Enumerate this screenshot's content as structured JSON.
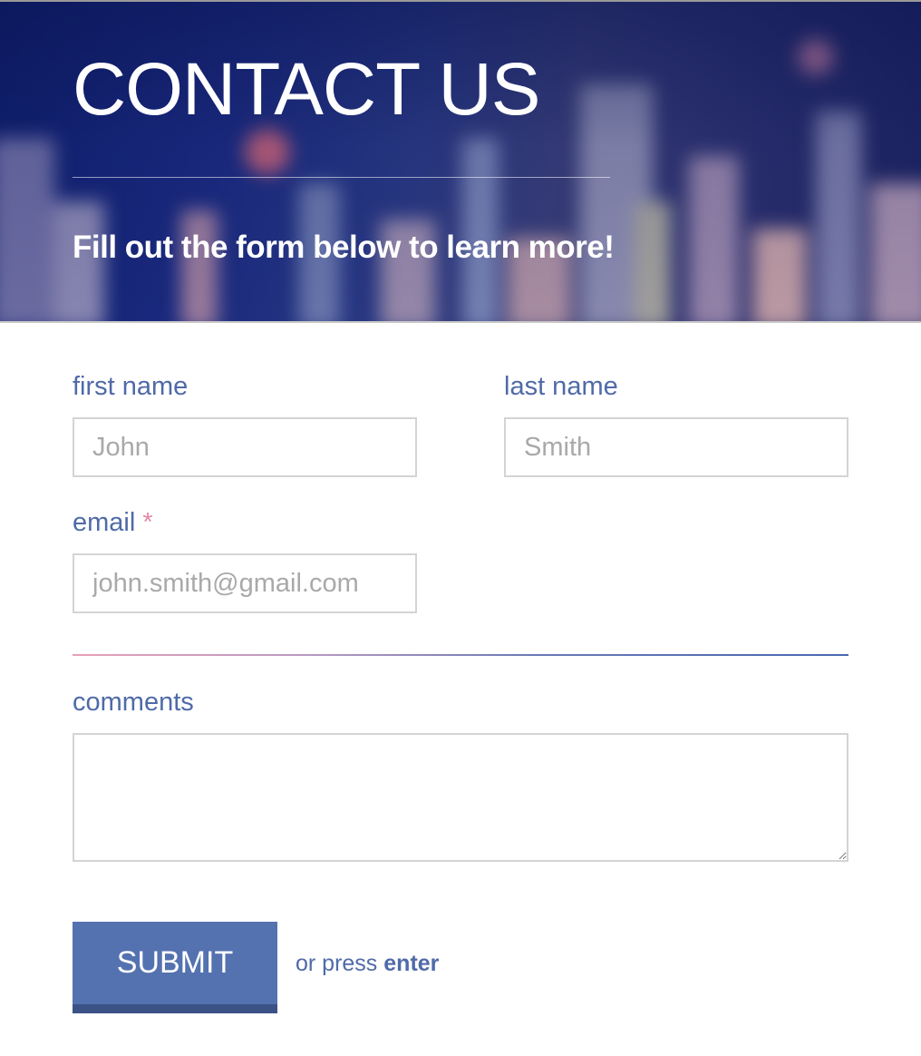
{
  "header": {
    "title": "CONTACT US",
    "subtitle": "Fill out the form below to learn more!"
  },
  "form": {
    "first_name": {
      "label": "first name",
      "placeholder": "John"
    },
    "last_name": {
      "label": "last name",
      "placeholder": "Smith"
    },
    "email": {
      "label": "email",
      "required_mark": "*",
      "placeholder": "john.smith@gmail.com"
    },
    "comments": {
      "label": "comments",
      "value": ""
    },
    "submit_label": "SUBMIT",
    "hint_prefix": "or press",
    "hint_key": "enter"
  },
  "colors": {
    "accent": "#5472b0",
    "accent_dark": "#3b5287",
    "label": "#4f6aa8",
    "required": "#e48aa8",
    "field_border": "#d4d4d4",
    "placeholder": "#a9a9a9"
  }
}
